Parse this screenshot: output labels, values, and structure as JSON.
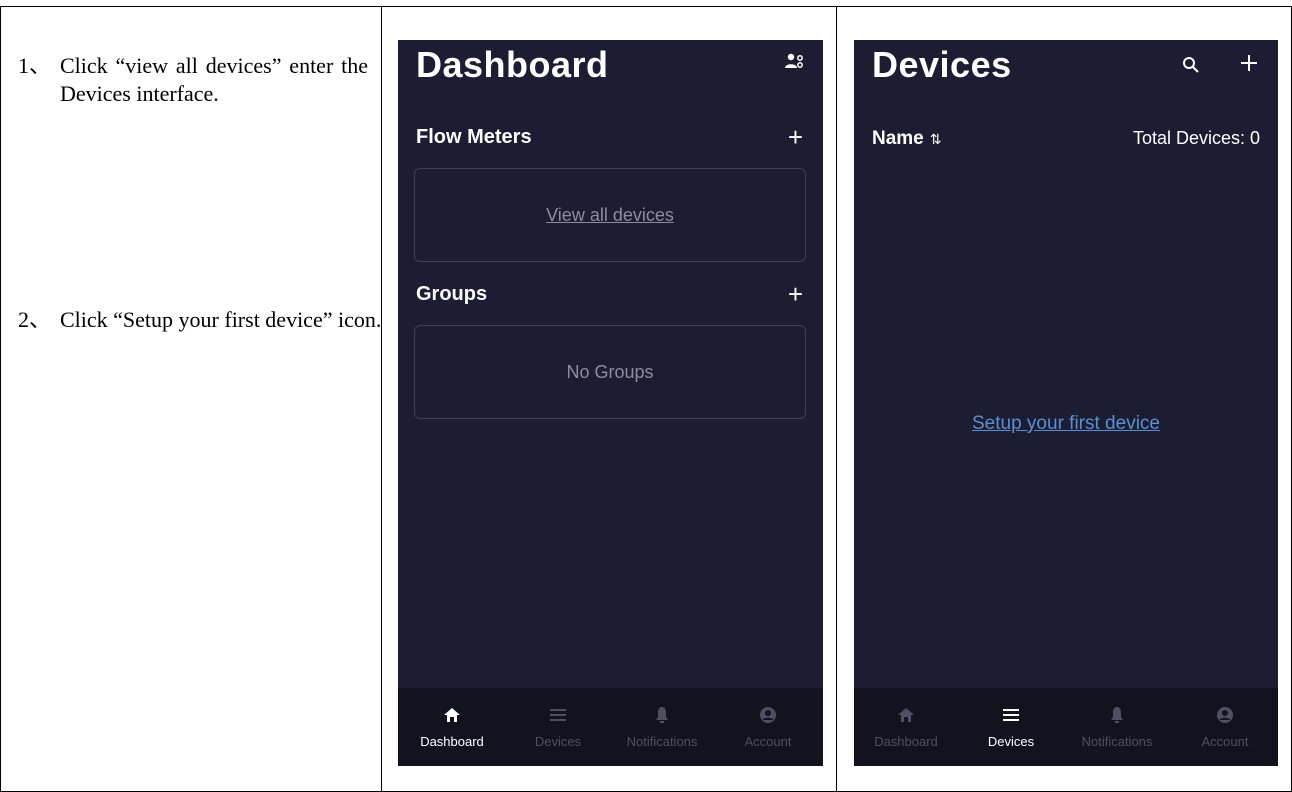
{
  "instructions": {
    "step1_num": "1、",
    "step1_text": "Click “view all devices” enter the Devices interface.",
    "step2_num": "2、",
    "step2_text": "Click “Setup your first device” icon."
  },
  "dashboard": {
    "title": "Dashboard",
    "header_icon": "user-settings-icon",
    "flow_meters_label": "Flow Meters",
    "flow_meters_plus": "+",
    "view_all_devices": "View all devices",
    "groups_label": "Groups",
    "groups_plus": "+",
    "no_groups": "No Groups",
    "tabs": [
      {
        "label": "Dashboard",
        "icon": "home-icon",
        "active": true
      },
      {
        "label": "Devices",
        "icon": "list-icon",
        "active": false
      },
      {
        "label": "Notifications",
        "icon": "bell-icon",
        "active": false
      },
      {
        "label": "Account",
        "icon": "account-icon",
        "active": false
      }
    ]
  },
  "devices": {
    "title": "Devices",
    "search_icon": "search-icon",
    "add_icon": "plus-icon",
    "name_label": "Name",
    "sort_glyph": "⇅",
    "total_label": "Total Devices: 0",
    "setup_link": "Setup your first device",
    "tabs": [
      {
        "label": "Dashboard",
        "icon": "home-icon",
        "active": false
      },
      {
        "label": "Devices",
        "icon": "list-icon",
        "active": true
      },
      {
        "label": "Notifications",
        "icon": "bell-icon",
        "active": false
      },
      {
        "label": "Account",
        "icon": "account-icon",
        "active": false
      }
    ]
  },
  "colors": {
    "panel_bg": "#1c1c32",
    "tabbar_bg": "#13131f",
    "link_blue": "#5b8fd1",
    "muted": "#8d8d9b"
  }
}
